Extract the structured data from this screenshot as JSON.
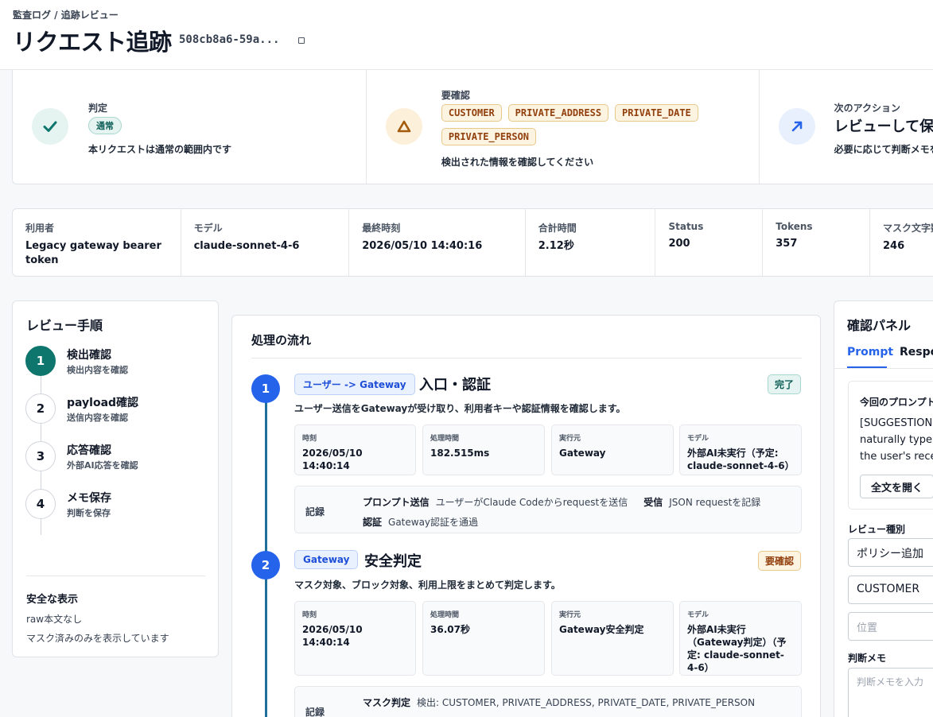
{
  "header": {
    "breadcrumb": "監査ログ / 追跡レビュー",
    "title": "リクエスト追跡",
    "request_id": "508cb8a6-59a..."
  },
  "summary": {
    "verdict": {
      "label": "判定",
      "badge": "通常",
      "text": "本リクエストは通常の範囲内です"
    },
    "review": {
      "label": "要確認",
      "tags": [
        "CUSTOMER",
        "PRIVATE_ADDRESS",
        "PRIVATE_DATE",
        "PRIVATE_PERSON"
      ],
      "text": "検出された情報を確認してください"
    },
    "next": {
      "label": "次のアクション",
      "title": "レビューして保存",
      "text": "必要に応じて判断メモを"
    }
  },
  "meta": [
    {
      "label": "利用者",
      "value": "Legacy gateway bearer token"
    },
    {
      "label": "モデル",
      "value": "claude-sonnet-4-6"
    },
    {
      "label": "最終時刻",
      "value": "2026/05/10 14:40:16"
    },
    {
      "label": "合計時間",
      "value": "2.12秒"
    },
    {
      "label": "Status",
      "value": "200"
    },
    {
      "label": "Tokens",
      "value": "357"
    },
    {
      "label": "マスク文字数",
      "value": "246"
    }
  ],
  "steps": {
    "title": "レビュー手順",
    "items": [
      {
        "num": "1",
        "title": "検出確認",
        "sub": "検出内容を確認"
      },
      {
        "num": "2",
        "title": "payload確認",
        "sub": "送信内容を確認"
      },
      {
        "num": "3",
        "title": "応答確認",
        "sub": "外部AI応答を確認"
      },
      {
        "num": "4",
        "title": "メモ保存",
        "sub": "判断を保存"
      }
    ],
    "safe_title": "安全な表示",
    "safe_line1": "raw本文なし",
    "safe_line2": "マスク済みのみを表示しています"
  },
  "flow": {
    "title": "処理の流れ",
    "stages": [
      {
        "num": "1",
        "tag": "ユーザー -> Gateway",
        "title": "入口・認証",
        "status": "完了",
        "desc": "ユーザー送信をGatewayが受け取り、利用者キーや認証情報を確認します。",
        "cells": [
          {
            "label": "時刻",
            "value": "2026/05/10 14:40:14"
          },
          {
            "label": "処理時間",
            "value": "182.515ms"
          },
          {
            "label": "実行元",
            "value": "Gateway"
          },
          {
            "label": "モデル",
            "value": "外部AI未実行（予定: claude-sonnet-4-6）"
          }
        ],
        "record_label": "記録",
        "records": [
          {
            "k": "プロンプト送信",
            "v": "ユーザーがClaude Codeからrequestを送信"
          },
          {
            "k": "受信",
            "v": "JSON requestを記録"
          },
          {
            "k": "認証",
            "v": "Gateway認証を通過"
          }
        ]
      },
      {
        "num": "2",
        "tag": "Gateway",
        "title": "安全判定",
        "status": "要確認",
        "desc": "マスク対象、ブロック対象、利用上限をまとめて判定します。",
        "cells": [
          {
            "label": "時刻",
            "value": "2026/05/10 14:40:14"
          },
          {
            "label": "処理時間",
            "value": "36.07秒"
          },
          {
            "label": "実行元",
            "value": "Gateway安全判定"
          },
          {
            "label": "モデル",
            "value": "外部AI未実行（Gateway判定）（予定: claude-sonnet-4-6）"
          }
        ],
        "record_label": "記録",
        "records": [
          {
            "k": "マスク判定",
            "v": "検出: CUSTOMER, PRIVATE_ADDRESS, PRIVATE_DATE, PRIVATE_PERSON"
          }
        ]
      }
    ]
  },
  "panel": {
    "title": "確認パネル",
    "tab_prompt": "Prompt",
    "tab_response": "Response",
    "prompt_heading": "今回のプロンプト",
    "prompt_text1": "[SUGGESTION",
    "prompt_text2": "naturally type n",
    "prompt_text3": "the user's recen",
    "open_full": "全文を開く",
    "review_type_label": "レビュー種別",
    "review_type_value": "ポリシー追加",
    "entity_value": "CUSTOMER",
    "position_placeholder": "位置",
    "memo_label": "判断メモ",
    "memo_placeholder": "判断メモを入力"
  },
  "colors": {
    "accent": "#2563eb",
    "ok": "#0f766e",
    "warn": "#b45309"
  }
}
